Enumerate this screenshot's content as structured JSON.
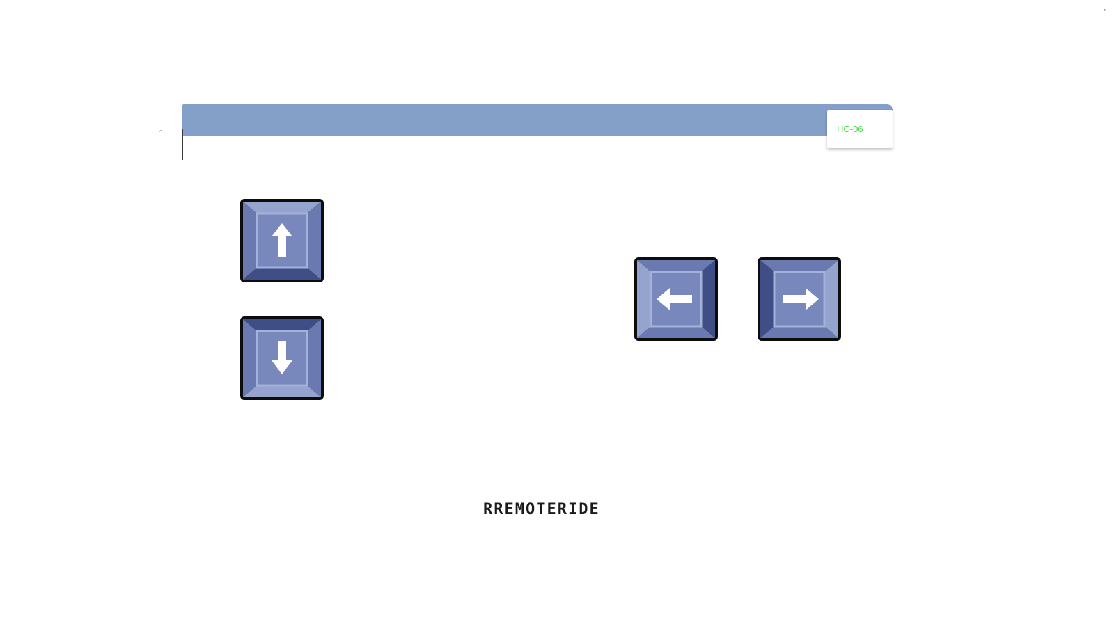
{
  "device": {
    "name": "HC-06",
    "status_color": "#33dd33"
  },
  "controls": {
    "up": {
      "icon": "arrow-up-icon"
    },
    "down": {
      "icon": "arrow-down-icon"
    },
    "left": {
      "icon": "arrow-left-icon"
    },
    "right": {
      "icon": "arrow-right-icon"
    }
  },
  "colors": {
    "top_bar": "#84a0c8",
    "key_face": "#7888bc",
    "key_dark": "#3f4e86",
    "key_light": "#95a3cf"
  },
  "footer": {
    "brand": "RREMOTERIDE"
  }
}
